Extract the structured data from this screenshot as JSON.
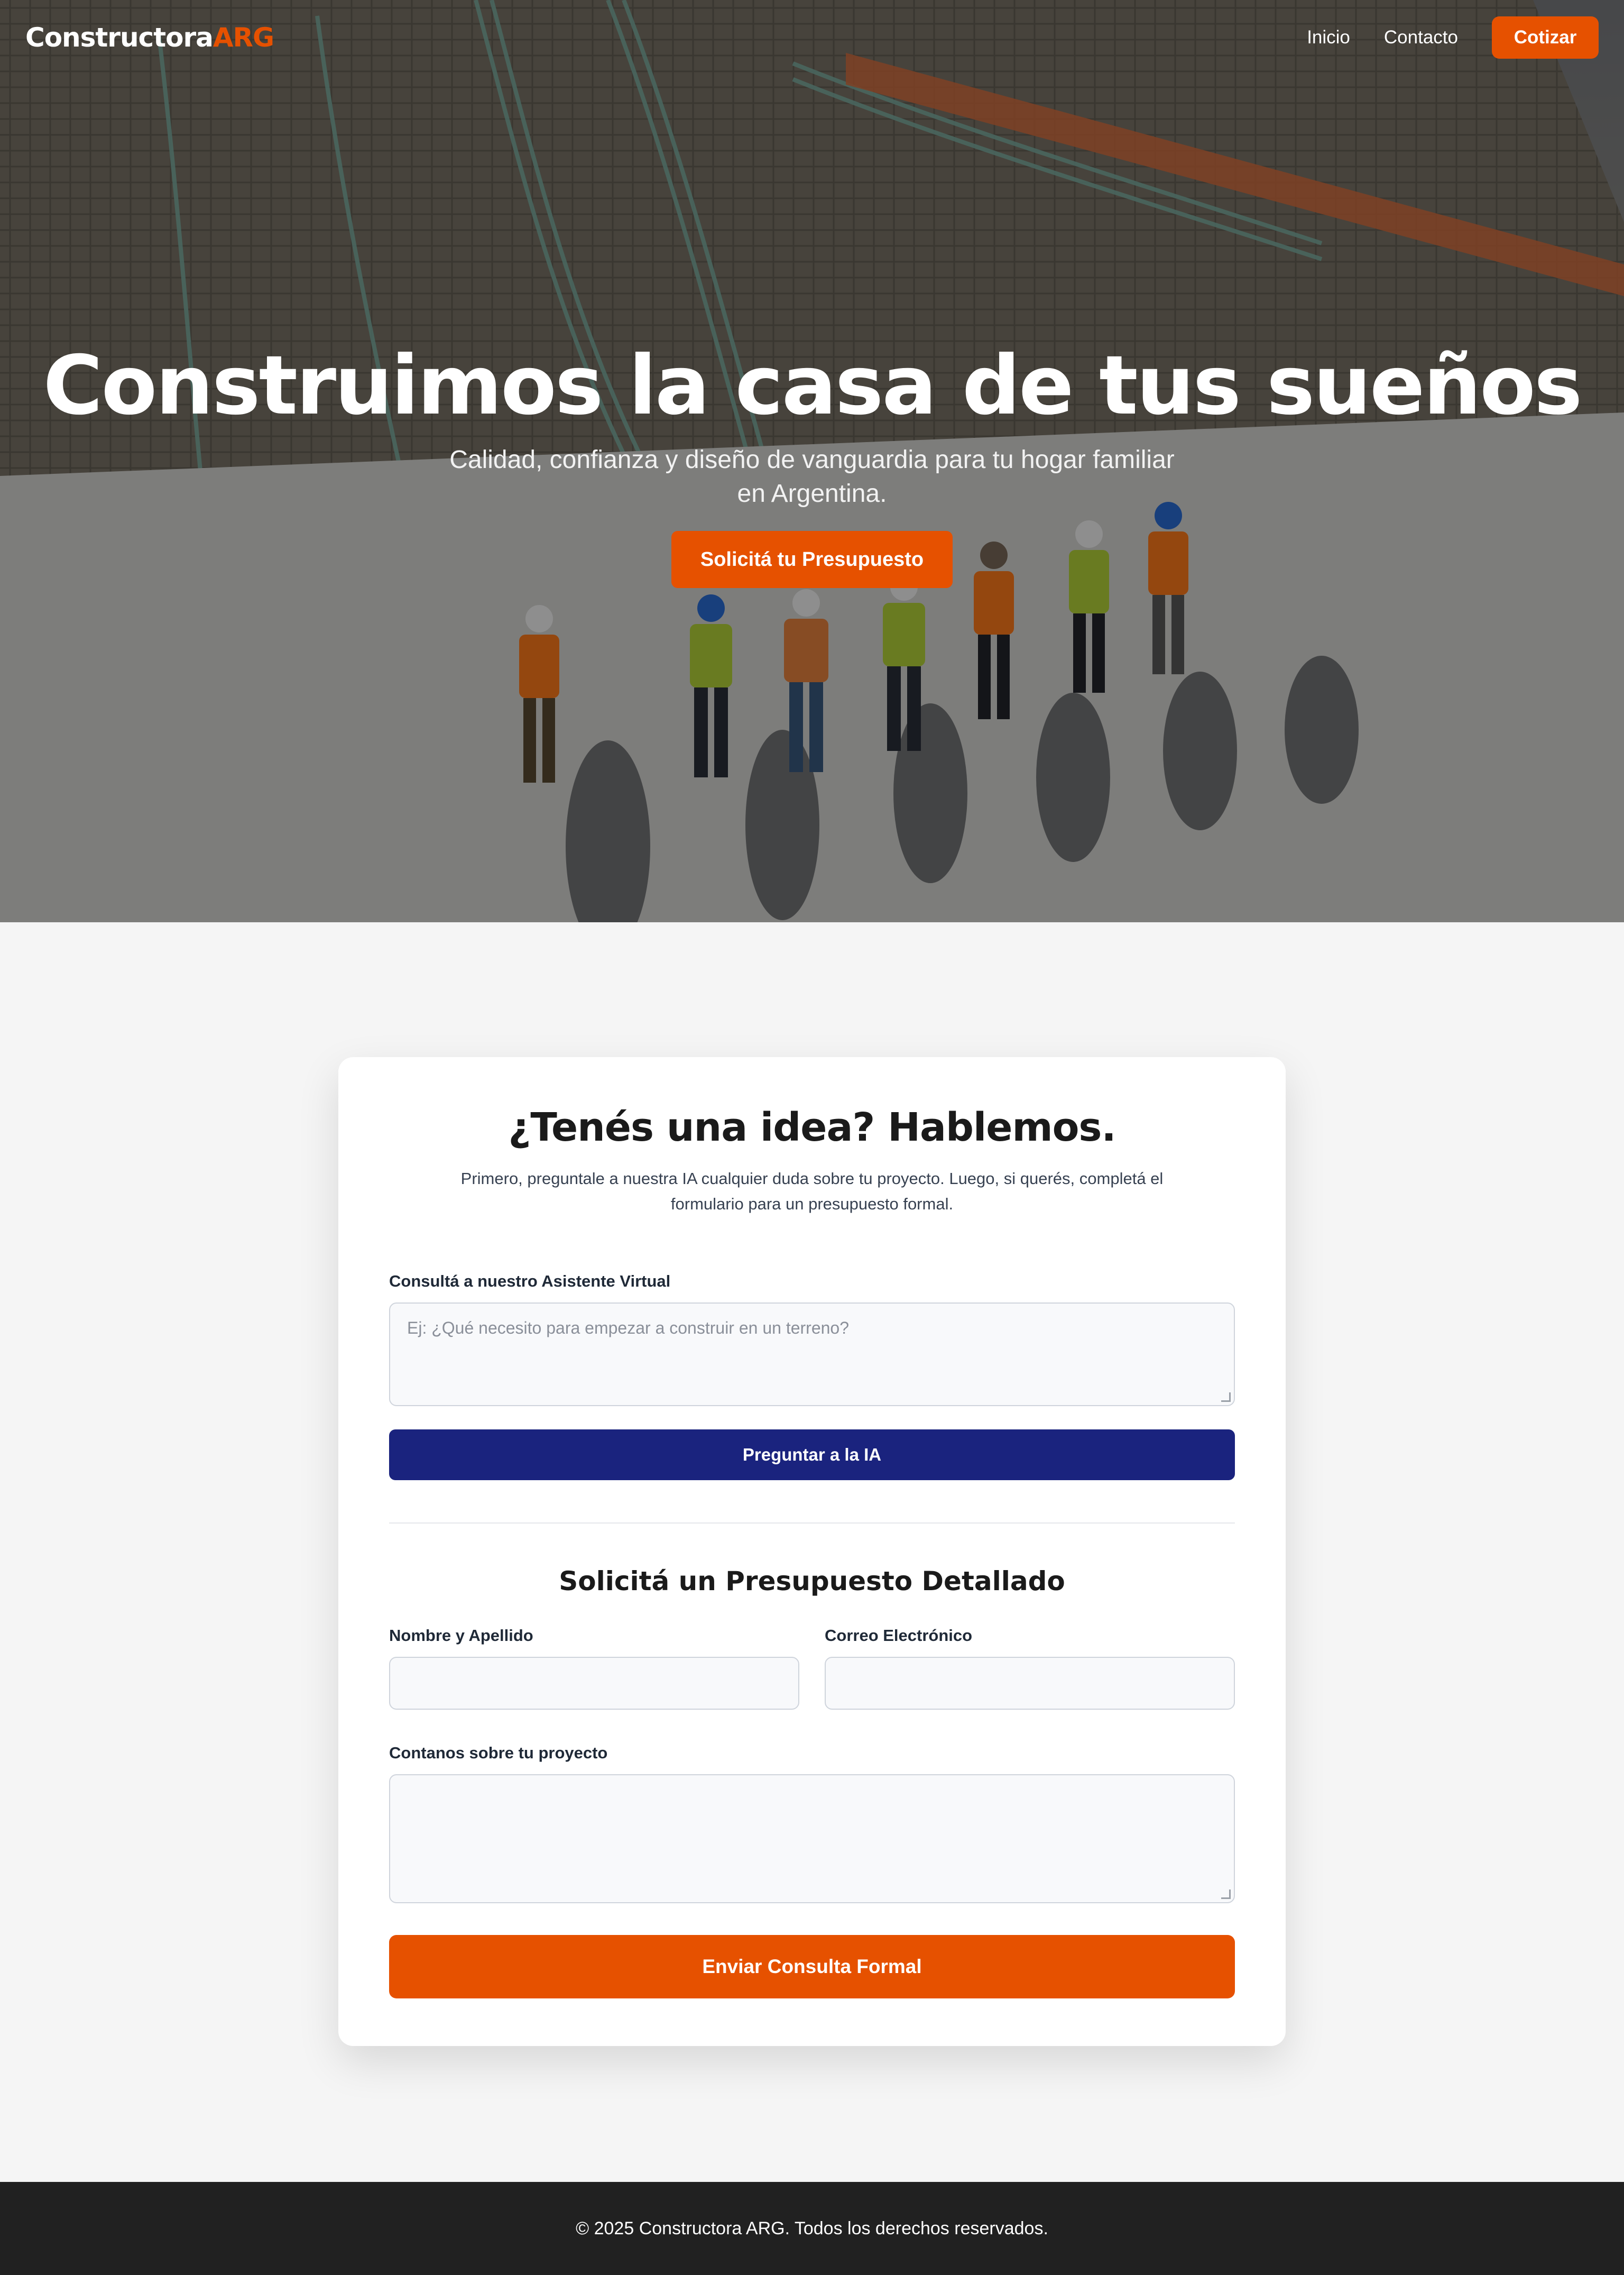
{
  "navbar": {
    "logo_main": "Constructora",
    "logo_accent": "ARG",
    "links": [
      "Inicio",
      "Contacto"
    ],
    "cta_label": "Cotizar"
  },
  "hero": {
    "title": "Construimos la casa de tus sueños",
    "subtitle": "Calidad, confianza y diseño de vanguardia para tu hogar familiar en Argentina.",
    "cta_label": "Solicitá tu Presupuesto"
  },
  "contact": {
    "title": "¿Tenés una idea? Hablemos.",
    "intro": "Primero, preguntale a nuestra IA cualquier duda sobre tu proyecto. Luego, si querés, completá el formulario para un presupuesto formal.",
    "ai": {
      "label": "Consultá a nuestro Asistente Virtual",
      "placeholder": "Ej: ¿Qué necesito para empezar a construir en un terreno?",
      "button_label": "Preguntar a la IA"
    },
    "form": {
      "title": "Solicitá un Presupuesto Detallado",
      "name_label": "Nombre y Apellido",
      "email_label": "Correo Electrónico",
      "project_label": "Contanos sobre tu proyecto",
      "submit_label": "Enviar Consulta Formal"
    }
  },
  "footer": {
    "text": "© 2025 Constructora ARG. Todos los derechos reservados."
  },
  "colors": {
    "accent": "#e65100",
    "primary_button": "#1a237e",
    "footer_bg": "#212121",
    "page_bg": "#f5f5f5"
  }
}
